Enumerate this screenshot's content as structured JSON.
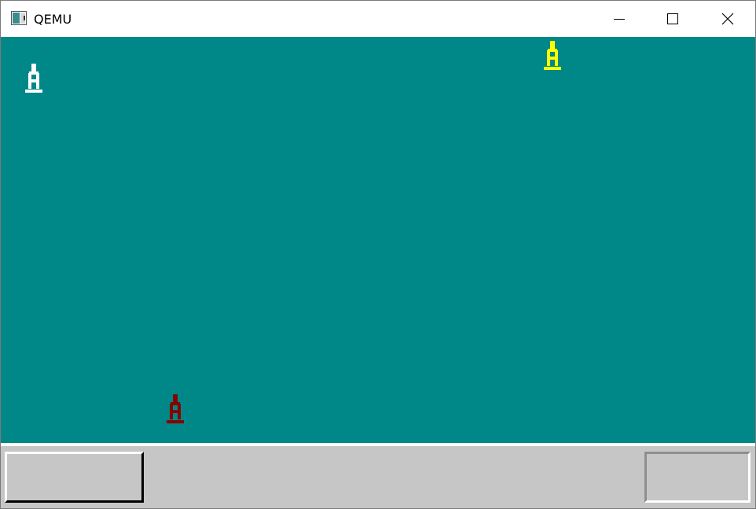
{
  "window": {
    "title": "QEMU",
    "controls": {
      "minimize_icon": "minimize-icon",
      "maximize_icon": "maximize-icon",
      "close_icon": "close-icon"
    }
  },
  "desktop": {
    "background_color": "#008787",
    "sprites": [
      {
        "name": "white-figure",
        "color": "#ffffff"
      },
      {
        "name": "yellow-figure",
        "color": "#ffff00"
      },
      {
        "name": "dark-red-figure",
        "color": "#870000"
      }
    ]
  },
  "taskbar": {
    "background_color": "#c6c6c6",
    "left_button_label": "",
    "right_button_label": ""
  }
}
